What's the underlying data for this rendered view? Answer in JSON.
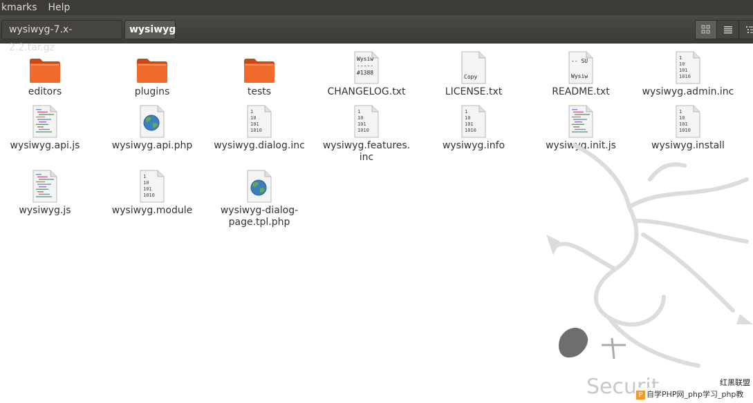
{
  "menubar": {
    "items": [
      "kmarks",
      "Help"
    ]
  },
  "breadcrumbs": [
    "wysiwyg-7.x-2.2.tar.gz",
    "wysiwyg"
  ],
  "view_buttons": [
    "icon-view-icon",
    "list-view-icon",
    "compact-view-icon"
  ],
  "files": [
    {
      "name": "editors",
      "type": "folder"
    },
    {
      "name": "plugins",
      "type": "folder"
    },
    {
      "name": "tests",
      "type": "folder"
    },
    {
      "name": "CHANGELOG.txt",
      "type": "text",
      "preview": [
        "Wysiw",
        "-----",
        "#1388"
      ]
    },
    {
      "name": "LICENSE.txt",
      "type": "text",
      "preview": [
        "Copy"
      ]
    },
    {
      "name": "README.txt",
      "type": "text",
      "preview": [
        "-- SU",
        "Wysiw"
      ]
    },
    {
      "name": "wysiwyg.admin.inc",
      "type": "binary"
    },
    {
      "name": "wysiwyg.api.js",
      "type": "script"
    },
    {
      "name": "wysiwyg.api.php",
      "type": "web"
    },
    {
      "name": "wysiwyg.dialog.inc",
      "type": "binary"
    },
    {
      "name": "wysiwyg.features.\ninc",
      "type": "binary"
    },
    {
      "name": "wysiwyg.info",
      "type": "binary"
    },
    {
      "name": "wysiwyg.init.js",
      "type": "script"
    },
    {
      "name": "wysiwyg.install",
      "type": "binary"
    },
    {
      "name": "wysiwyg.js",
      "type": "script"
    },
    {
      "name": "wysiwyg.module",
      "type": "binary"
    },
    {
      "name": "wysiwyg-dialog-\npage.tpl.php",
      "type": "web"
    }
  ],
  "binary_preview": [
    "1",
    "10",
    "101",
    "1010"
  ],
  "watermark": {
    "text": "Securit",
    "brand_top": "红黑联盟",
    "brand_bar": "自学PHP网_php学习_php教"
  },
  "colors": {
    "folder": "#f06a2c",
    "menubar": "#3c3b37",
    "globe": "#3a7fc1"
  }
}
